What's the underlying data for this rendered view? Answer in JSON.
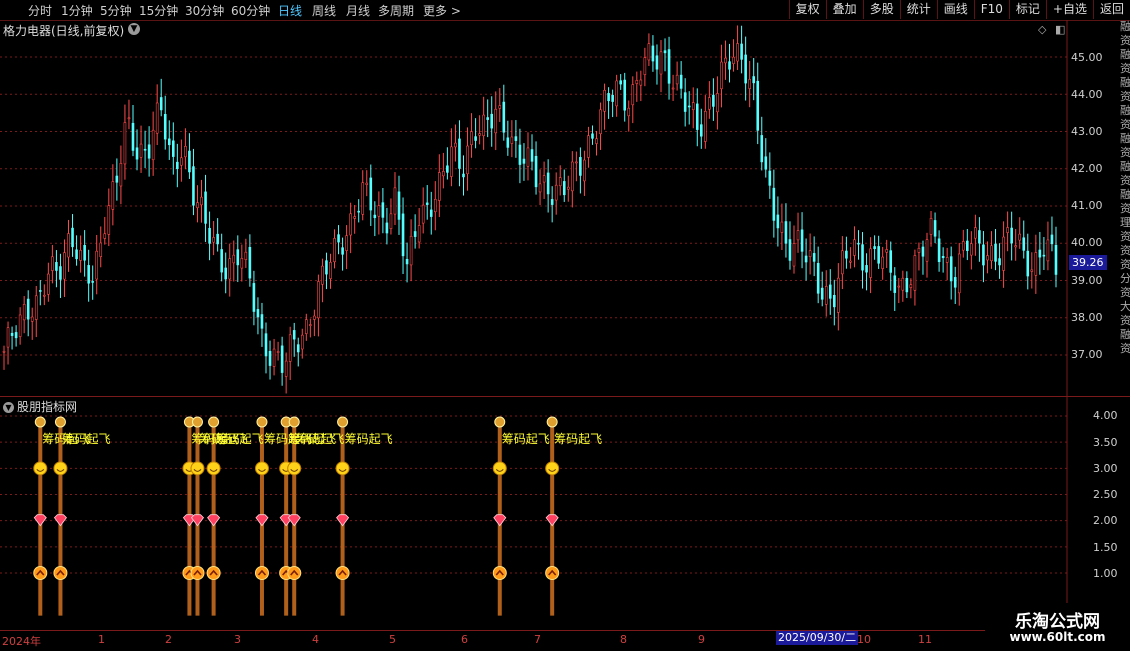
{
  "toolbar": {
    "periods": [
      "分时",
      "1分钟",
      "5分钟",
      "15分钟",
      "30分钟",
      "60分钟",
      "日线",
      "周线",
      "月线",
      "多周期",
      "更多 >"
    ],
    "active_period": "日线",
    "right_buttons": [
      "复权",
      "叠加",
      "多股",
      "统计",
      "画线",
      "F10",
      "标记",
      "+自选",
      "返回"
    ]
  },
  "stock": {
    "title": "格力电器(日线,前复权)",
    "current_price": "39.26"
  },
  "main_axis": {
    "labels": [
      "45.00",
      "44.00",
      "43.00",
      "42.00",
      "41.00",
      "40.00",
      "39.00",
      "38.00",
      "37.00"
    ]
  },
  "side_strip": [
    "融",
    "资",
    "融",
    "资",
    "融",
    "资",
    "融",
    "资",
    "融",
    "资",
    "融",
    "资",
    "融",
    "资",
    "理",
    "资",
    "资",
    "资",
    "分",
    "资",
    "大",
    "资",
    "融",
    "资"
  ],
  "indicator": {
    "title": "股朋指标网",
    "axis_labels": [
      "4.00",
      "3.50",
      "3.00",
      "2.50",
      "2.00",
      "1.50",
      "1.00"
    ],
    "signal_label": "筹码起飞"
  },
  "time_axis": {
    "labels": [
      "2024年",
      "1",
      "2",
      "3",
      "4",
      "5",
      "6",
      "7",
      "8",
      "9",
      "10",
      "11",
      "12"
    ],
    "cursor_date": "2025/09/30/二"
  },
  "watermark": {
    "line1": "乐淘公式网",
    "line2": "www.60lt.com"
  },
  "chart_data": {
    "type": "candlestick",
    "title": "格力电器(日线,前复权)",
    "y_range": [
      36.2,
      45.8
    ],
    "close_series_approx": [
      36.9,
      37.8,
      38.4,
      38.2,
      39.1,
      39.5,
      40.3,
      39.2,
      39.0,
      40.8,
      41.6,
      43.1,
      42.4,
      42.8,
      43.6,
      41.9,
      42.8,
      41.3,
      40.4,
      39.8,
      39.4,
      39.7,
      38.9,
      37.6,
      37.0,
      36.6,
      37.4,
      37.8,
      38.6,
      39.4,
      40.1,
      40.6,
      41.3,
      40.9,
      40.7,
      41.2,
      39.1,
      40.8,
      41.1,
      41.5,
      42.4,
      42.2,
      43.1,
      42.9,
      43.6,
      43.1,
      42.3,
      42.0,
      41.7,
      41.5,
      41.3,
      41.9,
      42.6,
      43.2,
      43.8,
      44.2,
      43.9,
      44.7,
      44.9,
      45.1,
      44.3,
      43.6,
      43.1,
      43.8,
      44.4,
      44.9,
      45.1,
      44.1,
      41.6,
      40.6,
      40.1,
      40.0,
      39.4,
      38.8,
      38.6,
      39.4,
      39.8,
      39.6,
      39.9,
      39.2,
      38.7,
      39.3,
      39.8,
      40.2,
      39.6,
      39.2,
      39.9,
      40.0,
      39.8,
      39.7,
      40.1,
      39.9,
      39.4,
      39.9,
      39.3
    ],
    "indicator_levels": [
      4.0,
      3.0,
      2.0,
      1.0
    ],
    "signal_dates_x_index": [
      9,
      14,
      46,
      48,
      52,
      64,
      70,
      72,
      84,
      123,
      136
    ]
  }
}
